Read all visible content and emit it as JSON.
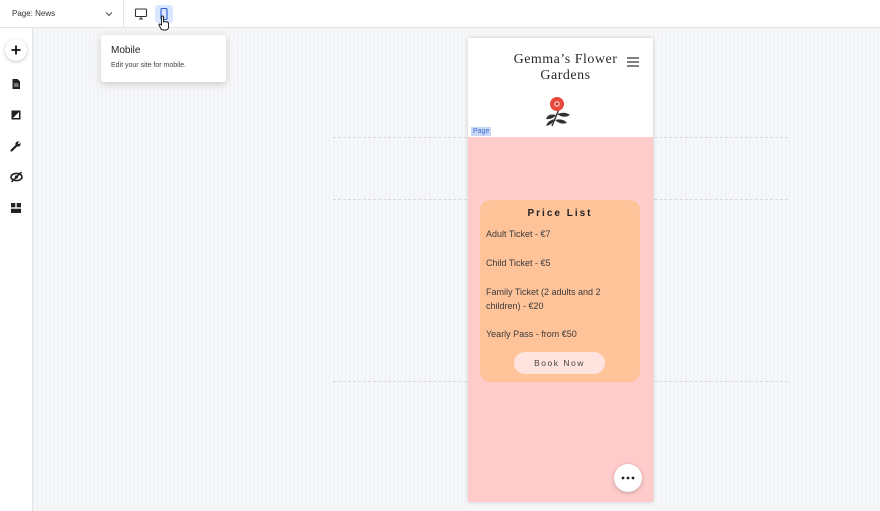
{
  "topbar": {
    "page_label": "Page: News",
    "tooltip": {
      "title": "Mobile",
      "description": "Edit your site for mobile."
    }
  },
  "left_toolbar": {
    "icons": [
      "add-icon",
      "pages-icon",
      "design-icon",
      "wrench-icon",
      "hidden-icon",
      "apps-icon"
    ]
  },
  "site": {
    "title": "Gemma’s Flower Gardens",
    "page_tag": "Page",
    "price_list": {
      "heading": "Price List",
      "items": [
        "Adult Ticket - €7",
        "Child Ticket - €5",
        "Family Ticket (2 adults and 2 children) - €20",
        "Yearly Pass - from €50"
      ],
      "button": "Book Now"
    }
  },
  "colors": {
    "page_bg": "#ffcccb",
    "card_bg": "#ffc39a",
    "button_bg": "#ffe3df",
    "flower": "#e8473d",
    "leaves": "#2e3330",
    "active_device": "#dbe7ff"
  }
}
